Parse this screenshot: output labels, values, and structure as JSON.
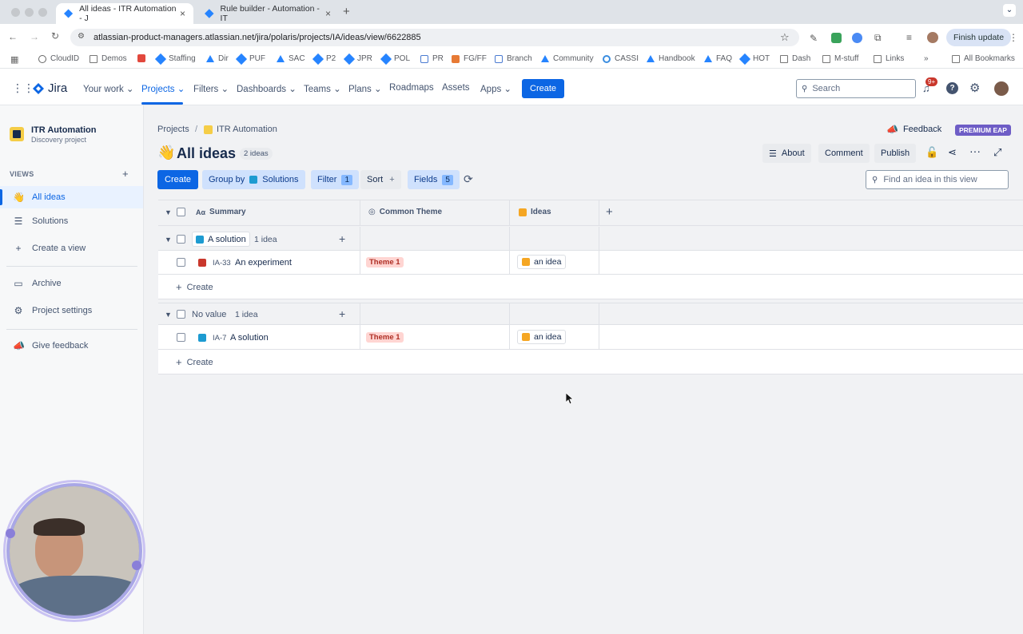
{
  "browser": {
    "tabs": [
      {
        "title": "All ideas - ITR Automation - J",
        "active": true
      },
      {
        "title": "Rule builder - Automation - IT",
        "active": false
      }
    ],
    "url": "atlassian-product-managers.atlassian.net/jira/polaris/projects/IA/ideas/view/6622885",
    "finish_update": "Finish update",
    "bookmarks": [
      "CloudID",
      "Demos",
      "Staffing",
      "Dir",
      "PUF",
      "SAC",
      "P2",
      "JPR",
      "POL",
      "PR",
      "FG/FF",
      "Branch",
      "Community",
      "CASSI",
      "Handbook",
      "FAQ",
      "HOT",
      "Dash",
      "M-stuff",
      "Links"
    ],
    "all_bookmarks": "All Bookmarks"
  },
  "jira": {
    "logo": "Jira",
    "nav": {
      "your_work": "Your work",
      "projects": "Projects",
      "filters": "Filters",
      "dashboards": "Dashboards",
      "teams": "Teams",
      "plans": "Plans",
      "roadmaps": "Roadmaps",
      "assets": "Assets",
      "apps": "Apps",
      "create": "Create"
    },
    "search_placeholder": "Search",
    "notif_badge": "9+"
  },
  "sidebar": {
    "project_name": "ITR Automation",
    "project_type": "Discovery project",
    "views_label": "VIEWS",
    "items": [
      {
        "label": "All ideas"
      },
      {
        "label": "Solutions"
      },
      {
        "label": "Create a view"
      },
      {
        "label": "Archive"
      },
      {
        "label": "Project settings"
      },
      {
        "label": "Give feedback"
      }
    ]
  },
  "page": {
    "breadcrumb_projects": "Projects",
    "breadcrumb_sep": "/",
    "breadcrumb_project": "ITR Automation",
    "feedback": "Feedback",
    "premium": "PREMIUM EAP",
    "title": "All ideas",
    "title_count": "2 ideas",
    "actions": {
      "about": "About",
      "comment": "Comment",
      "publish": "Publish"
    },
    "toolbar": {
      "create": "Create",
      "group_by": "Group by",
      "group_by_value": "Solutions",
      "filter": "Filter",
      "filter_count": "1",
      "sort": "Sort",
      "fields": "Fields",
      "fields_count": "5"
    },
    "find_placeholder": "Find an idea in this view"
  },
  "table": {
    "columns": [
      "Summary",
      "Common Theme",
      "Ideas"
    ],
    "groups": [
      {
        "name": "A solution",
        "count": "1 idea",
        "rows": [
          {
            "key": "IA-33",
            "summary": "An experiment",
            "theme": "Theme 1",
            "idea": "an idea"
          }
        ],
        "create": "Create"
      },
      {
        "name": "No value",
        "count": "1 idea",
        "rows": [
          {
            "key": "IA-7",
            "summary": "A solution",
            "theme": "Theme 1",
            "idea": "an idea"
          }
        ],
        "create": "Create"
      }
    ]
  }
}
